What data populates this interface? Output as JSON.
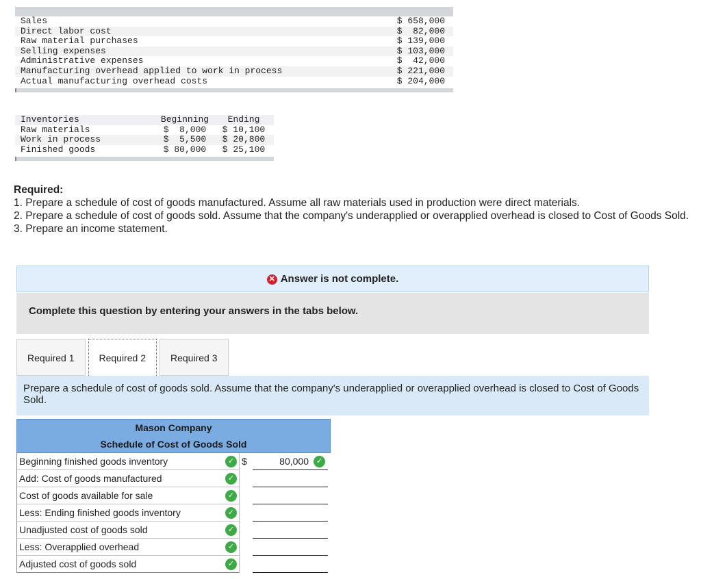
{
  "given": {
    "rows": [
      {
        "label": "Sales",
        "value": "$ 658,000"
      },
      {
        "label": "Direct labor cost",
        "value": "$  82,000"
      },
      {
        "label": "Raw material purchases",
        "value": "$ 139,000"
      },
      {
        "label": "Selling expenses",
        "value": "$ 103,000"
      },
      {
        "label": "Administrative expenses",
        "value": "$  42,000"
      },
      {
        "label": "Manufacturing overhead applied to work in process",
        "value": "$ 221,000"
      },
      {
        "label": "Actual manufacturing overhead costs",
        "value": "$ 204,000"
      }
    ]
  },
  "inventories": {
    "header": [
      "Inventories",
      "Beginning",
      "Ending"
    ],
    "rows": [
      {
        "label": "Raw materials",
        "beginning": "$  8,000",
        "ending": "$ 10,100"
      },
      {
        "label": "Work in process",
        "beginning": "$  5,500",
        "ending": "$ 20,800"
      },
      {
        "label": "Finished goods",
        "beginning": "$ 80,000",
        "ending": "$ 25,100"
      }
    ]
  },
  "required": {
    "title": "Required:",
    "items": [
      "1. Prepare a schedule of cost of goods manufactured. Assume all raw materials used in production were direct materials.",
      "2. Prepare a schedule of cost of goods sold. Assume that the company's underapplied or overapplied overhead is closed to Cost of Goods Sold.",
      "3. Prepare an income statement."
    ]
  },
  "banner": {
    "text": "Answer is not complete.",
    "status_color": "#d3232f"
  },
  "instructions": "Complete this question by entering your answers in the tabs below.",
  "tabs": [
    {
      "label": "Required 1",
      "active": false
    },
    {
      "label": "Required 2",
      "active": true
    },
    {
      "label": "Required 3",
      "active": false
    }
  ],
  "prompt": "Prepare a schedule of cost of goods sold. Assume that the company's underapplied or overapplied overhead is closed to Cost of Goods Sold.",
  "schedule": {
    "company": "Mason Company",
    "title": "Schedule of Cost of Goods Sold",
    "header_color": "#7bace1",
    "rows": [
      {
        "label": "Beginning finished goods inventory",
        "dollar": "$",
        "amount": "80,000"
      },
      {
        "label": "Add: Cost of goods manufactured",
        "dollar": "",
        "amount": ""
      },
      {
        "label": "Cost of goods available for sale",
        "dollar": "",
        "amount": ""
      },
      {
        "label": "Less: Ending finished goods inventory",
        "dollar": "",
        "amount": ""
      },
      {
        "label": "Unadjusted cost of goods sold",
        "dollar": "",
        "amount": ""
      },
      {
        "label": "Less: Overapplied overhead",
        "dollar": "",
        "amount": ""
      },
      {
        "label": "Adjusted cost of goods sold",
        "dollar": "",
        "amount": ""
      }
    ]
  }
}
